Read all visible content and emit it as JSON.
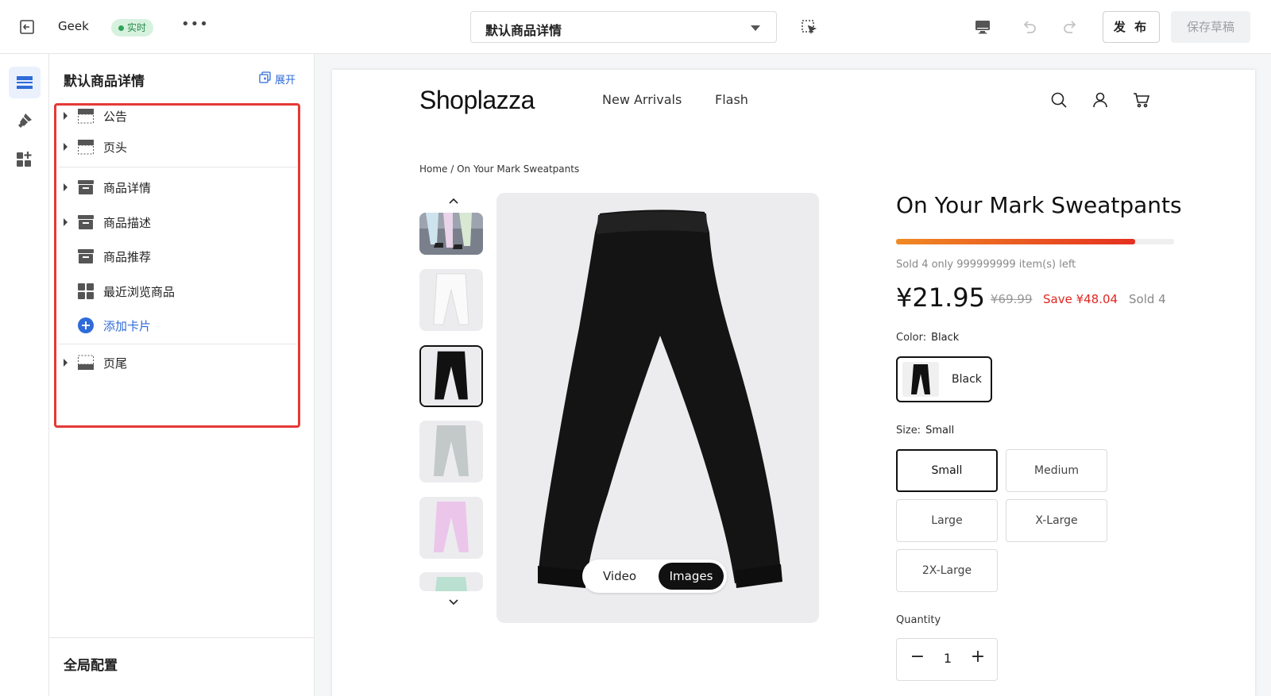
{
  "topbar": {
    "store_name": "Geek",
    "live_badge": "实时",
    "more": "•••",
    "template_select": "默认商品详情",
    "publish_label": "发 布",
    "save_draft_label": "保存草稿"
  },
  "panel": {
    "title": "默认商品详情",
    "expand_label": "展开",
    "sections": [
      {
        "label": "公告",
        "icon": "announcement-layout-icon"
      },
      {
        "label": "页头",
        "icon": "header-layout-icon"
      },
      {
        "label": "商品详情",
        "icon": "product-section-icon"
      },
      {
        "label": "商品描述",
        "icon": "product-section-icon"
      },
      {
        "label": "商品推荐",
        "icon": "product-section-icon"
      },
      {
        "label": "最近浏览商品",
        "icon": "grid-section-icon"
      },
      {
        "label": "添加卡片",
        "icon": "add-circle-icon"
      },
      {
        "label": "页尾",
        "icon": "footer-layout-icon"
      }
    ],
    "global_config": "全局配置",
    "accent_color": "#2f6bd9",
    "highlight_color": "#e53935"
  },
  "store": {
    "logo": "Shoplazza",
    "nav": [
      "New Arrivals",
      "Flash"
    ],
    "header_icons": [
      "search-icon",
      "account-icon",
      "cart-icon"
    ],
    "breadcrumb": "Home / On Your Mark Sweatpants",
    "media_toggle": {
      "video": "Video",
      "images": "Images"
    }
  },
  "product": {
    "title": "On Your Mark Sweatpants",
    "sold_progress": 0.86,
    "stock_text": "Sold 4 only 999999999 item(s) left",
    "price": "¥21.95",
    "compare_price": "¥69.99",
    "save_text": "Save ¥48.04",
    "sold_text": "Sold 4",
    "color_label": "Color:",
    "color_value": "Black",
    "color_option": "Black",
    "size_label": "Size:",
    "size_value": "Small",
    "sizes": [
      "Small",
      "Medium",
      "Large",
      "X-Large",
      "2X-Large"
    ],
    "quantity_label": "Quantity",
    "quantity": "1",
    "sale_color": "#e0271f"
  }
}
